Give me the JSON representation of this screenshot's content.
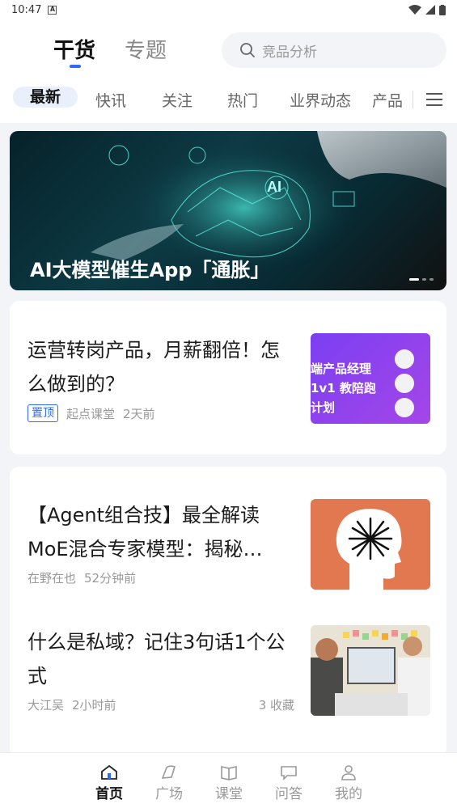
{
  "status": {
    "time": "10:47"
  },
  "top_tabs": [
    "干货",
    "专题"
  ],
  "search": {
    "placeholder": "竞品分析"
  },
  "categories": [
    "最新",
    "快讯",
    "关注",
    "热门",
    "业界动态",
    "产品"
  ],
  "banner": {
    "title": "AI大模型催生App「通胀」"
  },
  "articles": [
    {
      "title": "运营转岗产品，月薪翻倍！怎么做到的？",
      "badge": "置顶",
      "author": "起点课堂",
      "time": "2天前",
      "thumb_text": "端产品经理 1v1 教陪跑计划"
    },
    {
      "title": "【Agent组合技】最全解读MoE混合专家模型：揭秘…",
      "author": "在野在也",
      "time": "52分钟前"
    },
    {
      "title": "什么是私域？记住3句话1个公式",
      "author": "大江吴",
      "time": "2小时前",
      "favorites": "3 收藏"
    }
  ],
  "bottom_nav": [
    "首页",
    "广场",
    "课堂",
    "问答",
    "我的"
  ],
  "colors": {
    "accent": "#2f6cf5"
  }
}
